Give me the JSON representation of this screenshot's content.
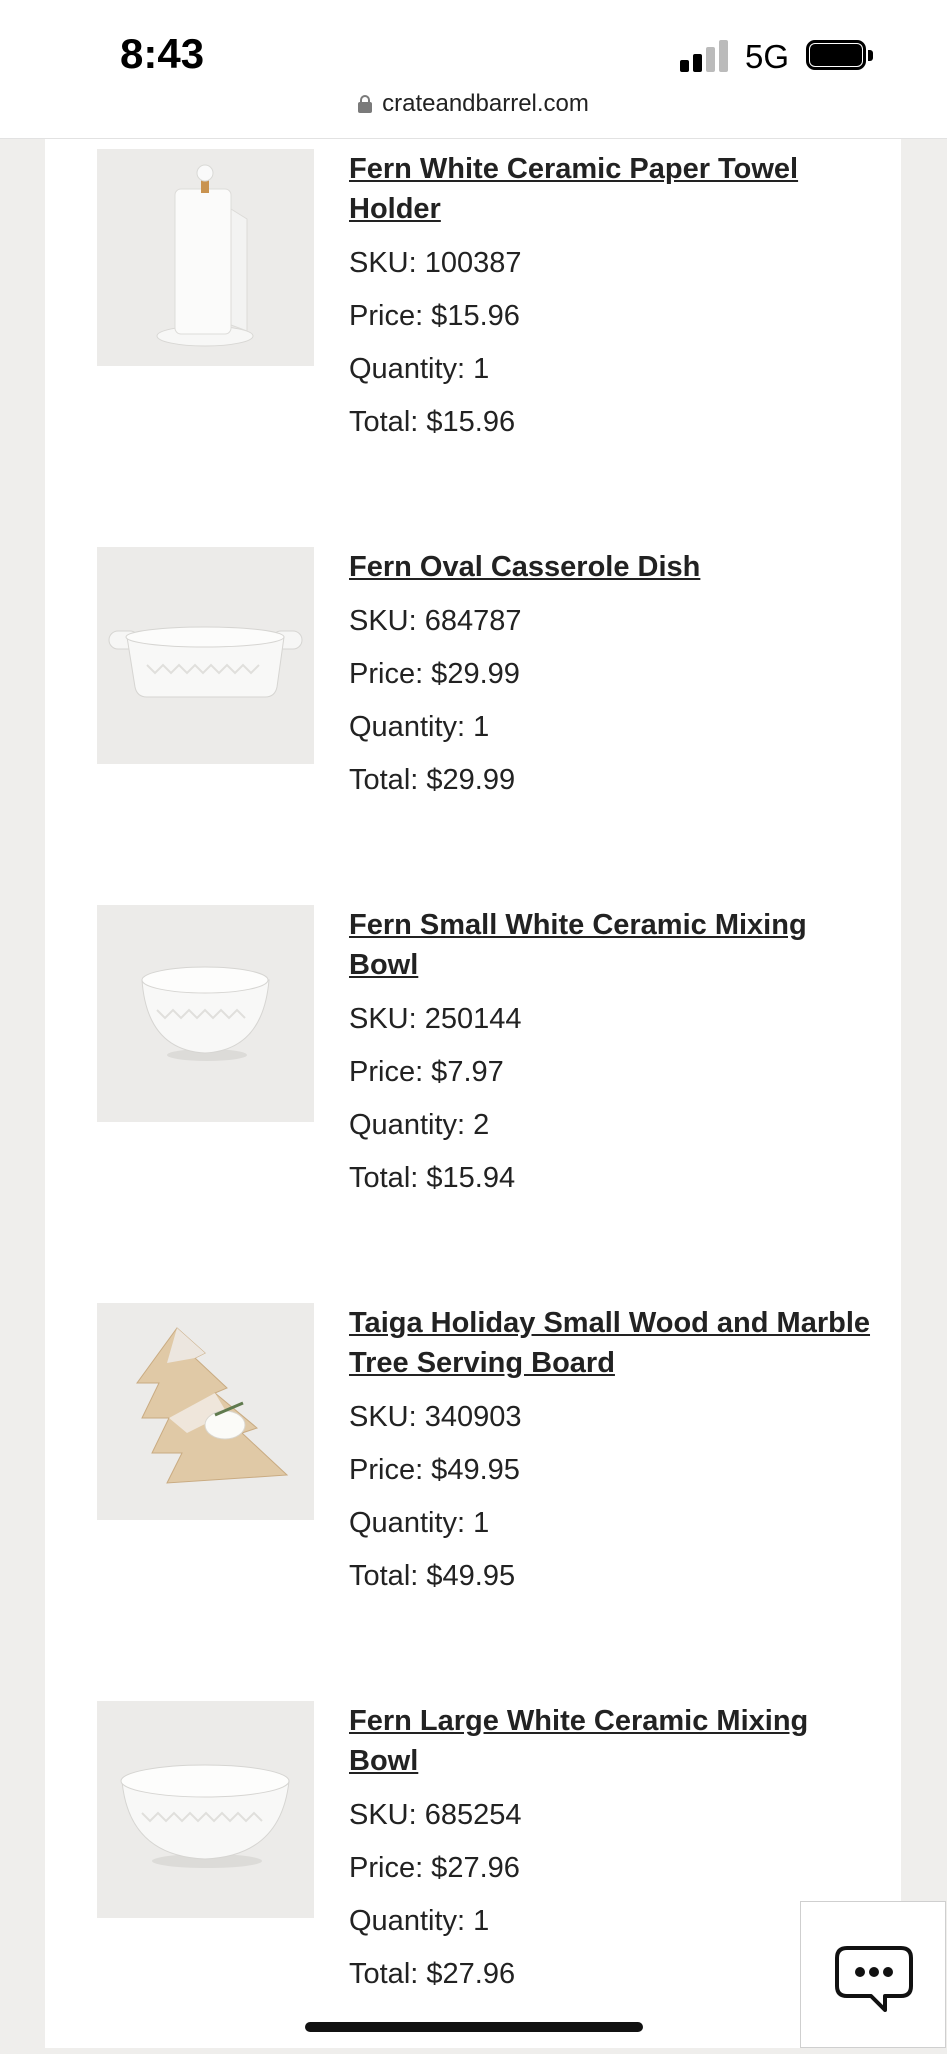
{
  "status_bar": {
    "time": "8:43",
    "network": "5G",
    "signal_icon": "cellular-signal-icon",
    "battery_icon": "battery-icon"
  },
  "browser": {
    "url": "crateandbarrel.com",
    "lock_icon": "lock-icon"
  },
  "items": [
    {
      "title": "Fern White Ceramic Paper Towel Holder",
      "sku": "SKU: 100387",
      "price": "Price: $15.96",
      "quantity": "Quantity: 1",
      "total": "Total: $15.96",
      "image": "paper-towel-holder-image"
    },
    {
      "title": "Fern Oval Casserole Dish",
      "sku": "SKU: 684787",
      "price": "Price: $29.99",
      "quantity": "Quantity: 1",
      "total": "Total: $29.99",
      "image": "casserole-dish-image"
    },
    {
      "title": "Fern Small White Ceramic Mixing Bowl",
      "sku": "SKU: 250144",
      "price": "Price: $7.97",
      "quantity": "Quantity: 2",
      "total": "Total: $15.94",
      "image": "small-mixing-bowl-image"
    },
    {
      "title": "Taiga Holiday Small Wood and Marble Tree Serving Board",
      "sku": "SKU: 340903",
      "price": "Price: $49.95",
      "quantity": "Quantity: 1",
      "total": "Total: $49.95",
      "image": "tree-serving-board-image"
    },
    {
      "title": "Fern Large White Ceramic Mixing Bowl",
      "sku": "SKU: 685254",
      "price": "Price: $27.96",
      "quantity": "Quantity: 1",
      "total": "Total: $27.96",
      "image": "large-mixing-bowl-image"
    }
  ],
  "chat": {
    "icon": "chat-bubble-icon"
  },
  "colors": {
    "page_background": "#efeeec",
    "card_background": "#ffffff",
    "text": "#222222"
  }
}
